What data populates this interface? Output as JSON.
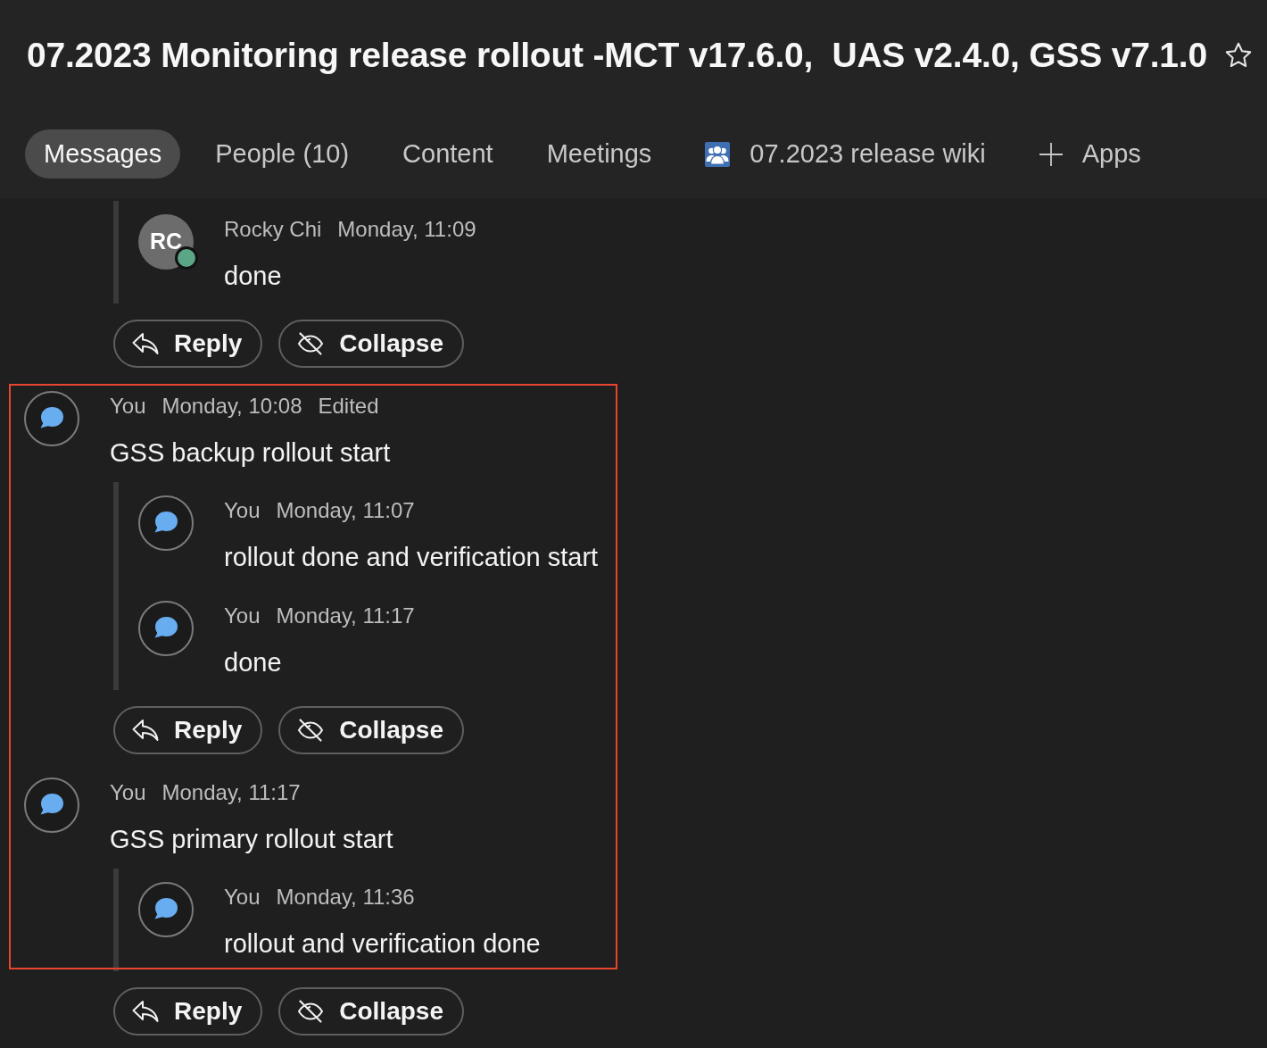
{
  "title": "07.2023 Monitoring release rollout -MCT v17.6.0,  UAS v2.4.0, GSS v7.1.0",
  "starred": false,
  "tabs": [
    {
      "label": "Messages",
      "kind": "text",
      "selected": true
    },
    {
      "label": "People (10)",
      "kind": "text",
      "selected": false
    },
    {
      "label": "Content",
      "kind": "text",
      "selected": false
    },
    {
      "label": "Meetings",
      "kind": "text",
      "selected": false
    },
    {
      "label": "07.2023 release wiki",
      "kind": "wiki",
      "selected": false
    },
    {
      "label": "Apps",
      "kind": "add",
      "selected": false
    }
  ],
  "threads": [
    {
      "replies": [
        {
          "author": "Rocky Chi",
          "time": "Monday, 11:09",
          "text": "done",
          "avatar": {
            "kind": "initials",
            "initials": "RC",
            "presence": {
              "color": "#5aa687"
            }
          },
          "highlighted": false
        }
      ],
      "actions": [
        {
          "kind": "reply",
          "label": "Reply"
        },
        {
          "kind": "collapse",
          "label": "Collapse"
        }
      ]
    },
    {
      "root": {
        "author": "You",
        "time": "Monday, 10:08",
        "note": "Edited",
        "text": "GSS backup rollout start",
        "avatar": {
          "kind": "chat"
        },
        "highlighted": true
      },
      "replies": [
        {
          "author": "You",
          "time": "Monday, 11:07",
          "text": "rollout done and verification start",
          "avatar": {
            "kind": "chat"
          },
          "highlighted": true
        },
        {
          "author": "You",
          "time": "Monday, 11:17",
          "text": "done",
          "avatar": {
            "kind": "chat"
          },
          "highlighted": true
        }
      ],
      "actions": [
        {
          "kind": "reply",
          "label": "Reply"
        },
        {
          "kind": "collapse",
          "label": "Collapse"
        }
      ]
    },
    {
      "root": {
        "author": "You",
        "time": "Monday, 11:17",
        "text": "GSS primary rollout start",
        "avatar": {
          "kind": "chat"
        },
        "highlighted": true
      },
      "replies": [
        {
          "author": "You",
          "time": "Monday, 11:36",
          "text": "rollout and verification done",
          "avatar": {
            "kind": "chat"
          },
          "highlighted": true
        }
      ],
      "actions": [
        {
          "kind": "reply",
          "label": "Reply"
        },
        {
          "kind": "collapse",
          "label": "Collapse"
        }
      ]
    }
  ]
}
